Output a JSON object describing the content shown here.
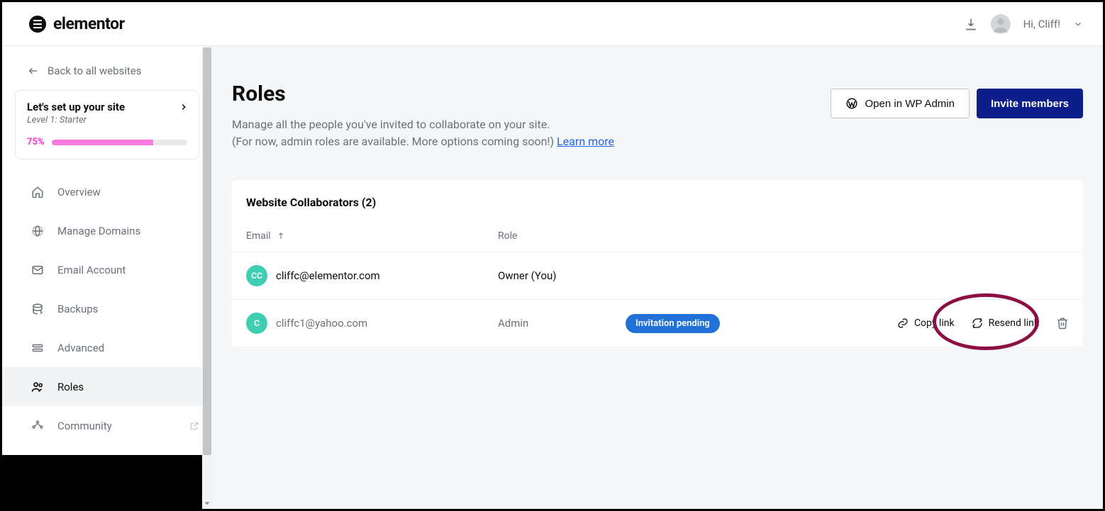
{
  "brand": "elementor",
  "header": {
    "greeting": "Hi, Cliff!"
  },
  "sidebar": {
    "back_label": "Back to all websites",
    "setup": {
      "title": "Let's set up your site",
      "level": "Level 1: Starter",
      "percent_label": "75%",
      "percent_value": 75
    },
    "items": [
      {
        "label": "Overview"
      },
      {
        "label": "Manage Domains"
      },
      {
        "label": "Email Account"
      },
      {
        "label": "Backups"
      },
      {
        "label": "Advanced"
      },
      {
        "label": "Roles"
      },
      {
        "label": "Community"
      }
    ]
  },
  "page": {
    "title": "Roles",
    "desc_line1": "Manage all the people you've invited to collaborate on your site.",
    "desc_line2": "(For now, admin roles are available. More options coming soon!) ",
    "learn_more": "Learn more",
    "open_wp": "Open in WP Admin",
    "invite_btn": "Invite members"
  },
  "collaborators": {
    "title": "Website Collaborators (2)",
    "col_email": "Email",
    "col_role": "Role",
    "rows": [
      {
        "initials": "CC",
        "email": "cliffc@elementor.com",
        "role": "Owner (You)"
      },
      {
        "initials": "C",
        "email": "cliffc1@yahoo.com",
        "role": "Admin",
        "status": "Invitation pending",
        "copy": "Copy link",
        "resend": "Resend link"
      }
    ],
    "copy_label": "Copy link",
    "resend_label": "Resend link"
  }
}
